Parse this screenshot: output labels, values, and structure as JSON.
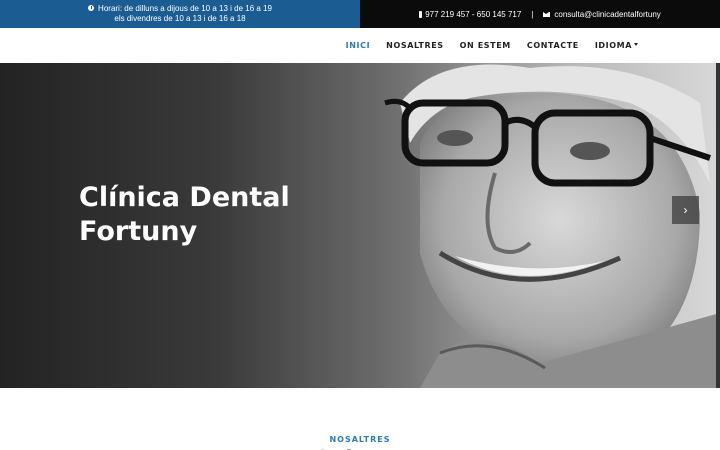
{
  "topbar": {
    "hours_line1": "Horari: de dilluns a dijous de 10 a 13 i de 16 a 19",
    "hours_line2": "els divendres de 10 a 13 i de 16 a 18",
    "phone": "977 219 457 - 650 145 717",
    "separator": "|",
    "email": "consulta@clinicadentalfortuny",
    "colors": {
      "left_bg": "#1b5d93",
      "right_bg": "#0b0b0b"
    }
  },
  "nav": {
    "items": [
      {
        "label": "INICI",
        "active": true
      },
      {
        "label": "NOSALTRES",
        "active": false
      },
      {
        "label": "ON ESTEM",
        "active": false
      },
      {
        "label": "CONTACTE",
        "active": false
      },
      {
        "label": "IDIOMA",
        "active": false,
        "dropdown": true
      }
    ],
    "accent": "#2b7bbd"
  },
  "hero": {
    "title_line1": "Clínica Dental",
    "title_line2": "Fortuny",
    "next_label": "›"
  },
  "section": {
    "kicker": "NOSALTRES",
    "heading": "Qui som"
  },
  "icons": [
    "clock-icon",
    "phone-icon",
    "envelope-icon",
    "caret-down-icon",
    "chevron-right-icon"
  ]
}
